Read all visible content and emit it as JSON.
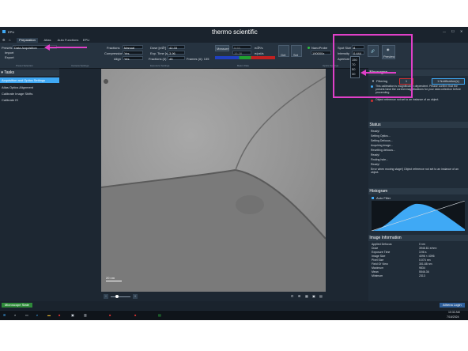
{
  "window": {
    "app_name": "EPU",
    "brand": "thermo scientific"
  },
  "tabs": [
    "Preparation",
    "Atlas",
    "Auto Functions",
    "EPU"
  ],
  "left_controls": {
    "presets_label": "Presets",
    "presets_value": "Data Acquisition",
    "import_label": "Import",
    "export_label": "Export"
  },
  "left_panel": {
    "title": "Tasks",
    "items": [
      "Acquisition and Optics Settings",
      "Atlas Optics Alignment",
      "Calibrate Image Shifts",
      "Calibrate IS"
    ]
  },
  "optics": {
    "fractions_label": "Fractions",
    "fractions_value": "Manual",
    "compression_label": "Compression",
    "compression_value": "Yes",
    "align_label": "Align",
    "align_value": "Yes"
  },
  "exposure": {
    "dose_label": "Dose [e/Å²]",
    "dose_value": "42.33",
    "exp_time_label": "Exp. Time [s]",
    "exp_time_value": "3.96",
    "fractions_label": "Fractions (#)",
    "fractions_value": "45",
    "frames_label": "Frames (#): 135",
    "nanoprobe_label": "NanoProbe",
    "mag_value": "190000x",
    "spot_label": "Spot Size",
    "spot_value": "8",
    "intensity_label": "Intensity",
    "intensity_value": "0.444",
    "aperture_label": "Aperture",
    "aperture_options": [
      "150",
      "70",
      "50",
      "30"
    ],
    "measure_label": "Measure",
    "measure_value1": "5.53",
    "measure_value2": "15.38",
    "unit1": "e/Å²/s",
    "unit2": "e/pxl/s"
  },
  "ribbon_sections": [
    "Preset Selection",
    "Camera Settings",
    "Exposure Settings",
    "Beam Rate",
    "Optics Settings"
  ],
  "ribbon_buttons": {
    "get": "Get",
    "set": "Set",
    "preview": "Preview"
  },
  "image": {
    "scale_label": "20 nm"
  },
  "right_panel": {
    "messages_title": "Messages",
    "filtering_label": "Filtering",
    "badge1": "1",
    "badge2": "1 Notification(s)",
    "message_text": "This calibration is magnification dependent. Please confirm that the presets have the correct magnifications for your data collection before proceeding.",
    "error_text": "Object reference not set to an instance of an object.",
    "status_title": "Status",
    "status_lines": [
      "Ready!",
      "Setting Optics...",
      "Setting Defocus...",
      "Acquiring image...",
      "Resetting defocus...",
      "Ready!",
      "Finding hole...",
      "Ready!",
      "Error when moving stage!( Object reference not set to an instance of an object."
    ],
    "histogram_title": "Histogram",
    "auto_filter": "Auto Filter",
    "info_title": "Image Information",
    "info": [
      [
        "Applied Defocus",
        "0 nm"
      ],
      [
        "Dose",
        "3946.61 e/nm²"
      ],
      [
        "Exposure Time",
        "3.96 s"
      ],
      [
        "Image Size",
        "4096 × 4096"
      ],
      [
        "Pixel Size",
        "0.074 nm"
      ],
      [
        "Field Of View",
        "301.88 nm"
      ],
      [
        "Maximum",
        "9834"
      ],
      [
        "Mean",
        "5546.36"
      ],
      [
        "Minimum",
        "2313"
      ]
    ]
  },
  "statusbar": {
    "left": "Microscope State",
    "right": "Athena Login"
  },
  "taskbar": {
    "time": "10:32 AM",
    "date": "7/16/2024"
  },
  "colors": {
    "bg": "#1d2732",
    "accent": "#3fa9f5",
    "highlight": "#e040c8",
    "error": "#d03030"
  }
}
